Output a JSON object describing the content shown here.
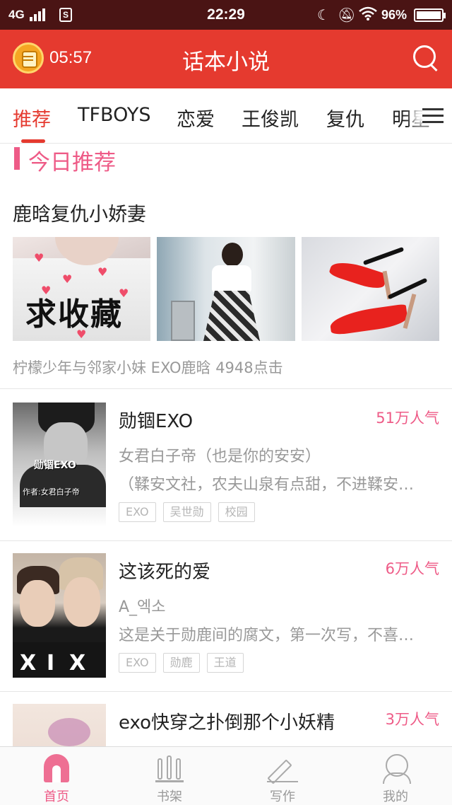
{
  "status_bar": {
    "network": "4G",
    "sim_icon": "S",
    "time": "22:29",
    "battery_pct": "96%",
    "icons": [
      "moon-icon",
      "bell-off-icon",
      "wifi-icon"
    ]
  },
  "header": {
    "timer": "05:57",
    "title": "话本小说"
  },
  "tabs": [
    {
      "label": "推荐",
      "active": true
    },
    {
      "label": "TFBOYS"
    },
    {
      "label": "恋爱"
    },
    {
      "label": "王俊凯"
    },
    {
      "label": "复仇"
    },
    {
      "label": "明星"
    }
  ],
  "today": {
    "section_label": "今日推荐",
    "feature": {
      "title": "鹿晗复仇小娇妻",
      "image1_caption": "求收藏",
      "meta": "柠檬少年与邻家小妹   EXO鹿晗   4948点击"
    }
  },
  "books": [
    {
      "title": "勋锢EXO",
      "popularity": "51万人气",
      "author": "女君白子帝（也是你的安安）",
      "desc": "（鞣安文社，农夫山泉有点甜，不进鞣安…",
      "tags": [
        "EXO",
        "吴世勋",
        "校园"
      ],
      "cover_title": "勋锢EXO",
      "cover_author": "作者:女君白子帝"
    },
    {
      "title": "这该死的爱",
      "popularity": "6万人气",
      "author": "A_엑소",
      "desc": "这是关于勋鹿间的腐文，第一次写，不喜…",
      "tags": [
        "EXO",
        "勋鹿",
        "王道"
      ]
    },
    {
      "title": "exo快穿之扑倒那个小妖精",
      "popularity": "3万人气"
    }
  ],
  "bottom_nav": [
    {
      "label": "首页",
      "active": true,
      "icon": "home-icon"
    },
    {
      "label": "书架",
      "icon": "bookshelf-icon"
    },
    {
      "label": "写作",
      "icon": "pen-icon"
    },
    {
      "label": "我的",
      "icon": "profile-icon"
    }
  ],
  "colors": {
    "status_bar": "#4a1414",
    "header": "#e53a2f",
    "accent_pink": "#ee5b87",
    "tag_border": "#d6d6d6"
  }
}
